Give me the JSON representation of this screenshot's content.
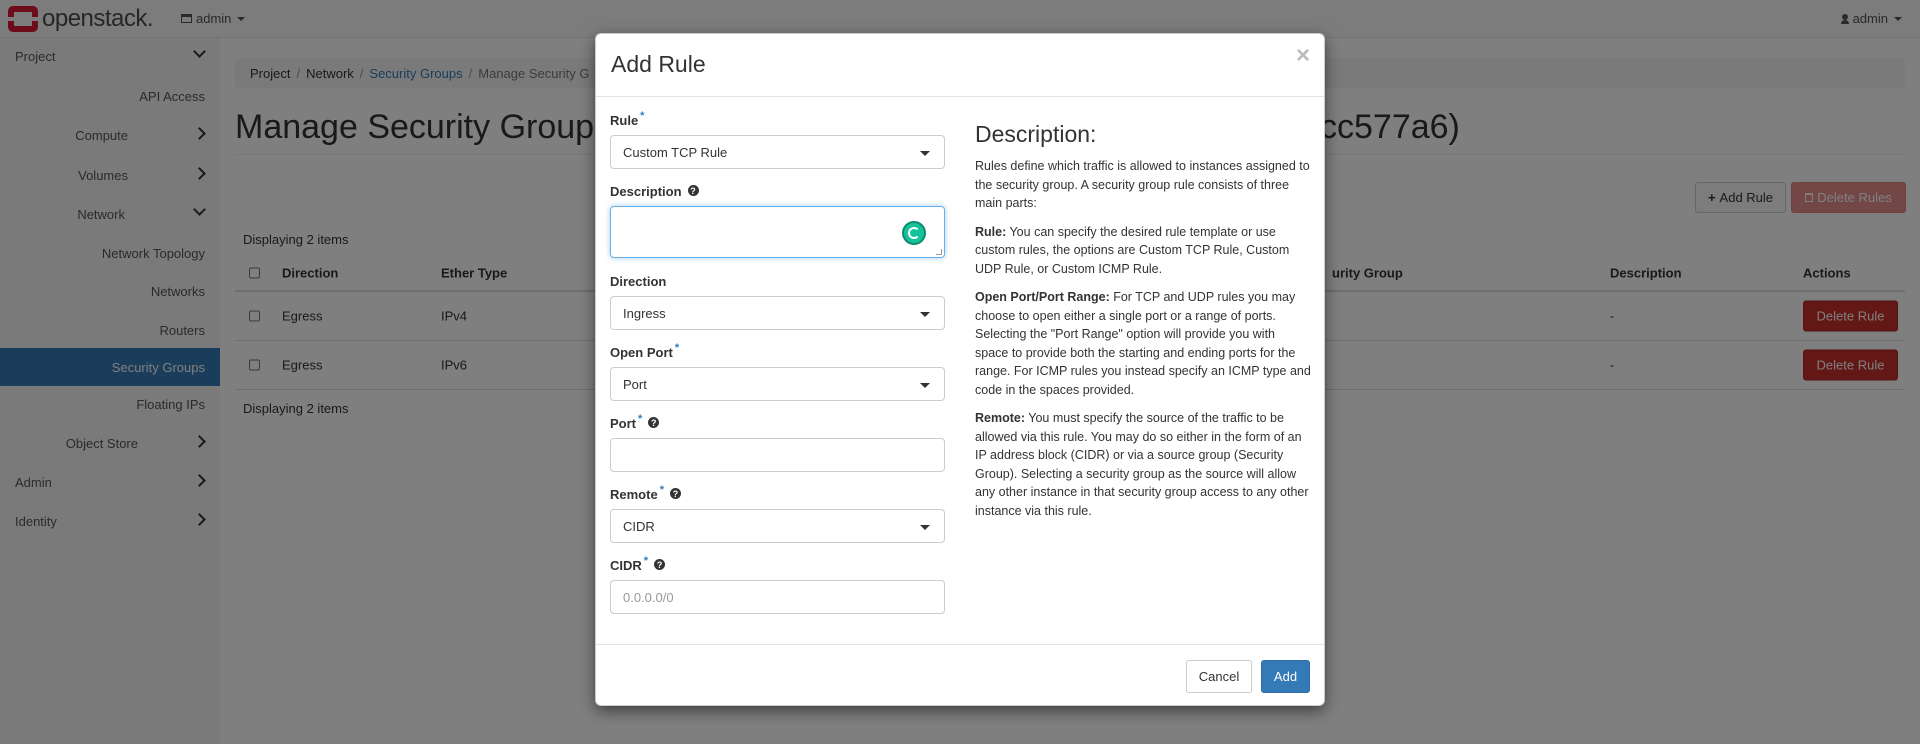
{
  "navbar": {
    "brand": "openstack.",
    "project_selector": "admin",
    "user_menu": "admin"
  },
  "sidebar": {
    "items": [
      {
        "label": "Project"
      },
      {
        "label": "API Access"
      },
      {
        "label": "Compute"
      },
      {
        "label": "Volumes"
      },
      {
        "label": "Network"
      },
      {
        "label": "Network Topology"
      },
      {
        "label": "Networks"
      },
      {
        "label": "Routers"
      },
      {
        "label": "Security Groups"
      },
      {
        "label": "Floating IPs"
      },
      {
        "label": "Object Store"
      },
      {
        "label": "Admin"
      },
      {
        "label": "Identity"
      }
    ]
  },
  "breadcrumb": {
    "items": [
      "Project",
      "Network",
      "Security Groups",
      "Manage Security G"
    ]
  },
  "page": {
    "title_visible": "Manage Security Group",
    "title_tail": "cc577a6)",
    "add_rule_label": "Add Rule",
    "delete_rules_label": "Delete Rules",
    "count_text": "Displaying 2 items"
  },
  "table": {
    "headers": {
      "direction": "Direction",
      "ether_type": "Ether Type",
      "remote_group": "urity Group",
      "description": "Description",
      "actions": "Actions"
    },
    "rows": [
      {
        "direction": "Egress",
        "ether_type": "IPv4",
        "description": "-",
        "action": "Delete Rule"
      },
      {
        "direction": "Egress",
        "ether_type": "IPv6",
        "description": "-",
        "action": "Delete Rule"
      }
    ]
  },
  "modal": {
    "title": "Add Rule",
    "close": "×",
    "fields": {
      "rule": {
        "label": "Rule",
        "value": "Custom TCP Rule"
      },
      "description": {
        "label": "Description",
        "value": ""
      },
      "direction": {
        "label": "Direction",
        "value": "Ingress"
      },
      "open_port": {
        "label": "Open Port",
        "value": "Port"
      },
      "port": {
        "label": "Port",
        "value": ""
      },
      "remote": {
        "label": "Remote",
        "value": "CIDR"
      },
      "cidr": {
        "label": "CIDR",
        "placeholder": "0.0.0.0/0"
      }
    },
    "help": {
      "heading": "Description:",
      "intro": "Rules define which traffic is allowed to instances assigned to the security group. A security group rule consists of three main parts:",
      "rule_title": "Rule:",
      "rule_text": " You can specify the desired rule template or use custom rules, the options are Custom TCP Rule, Custom UDP Rule, or Custom ICMP Rule.",
      "port_title": "Open Port/Port Range:",
      "port_text": " For TCP and UDP rules you may choose to open either a single port or a range of ports. Selecting the \"Port Range\" option will provide you with space to provide both the starting and ending ports for the range. For ICMP rules you instead specify an ICMP type and code in the spaces provided.",
      "remote_title": "Remote:",
      "remote_text": " You must specify the source of the traffic to be allowed via this rule. You may do so either in the form of an IP address block (CIDR) or via a source group (Security Group). Selecting a security group as the source will allow any other instance in that security group access to any other instance via this rule."
    },
    "cancel_label": "Cancel",
    "submit_label": "Add"
  },
  "colors": {
    "primary": "#337ab7",
    "danger": "#d9534f",
    "brand_red": "#da1a32",
    "grammarly": "#15c39a"
  }
}
